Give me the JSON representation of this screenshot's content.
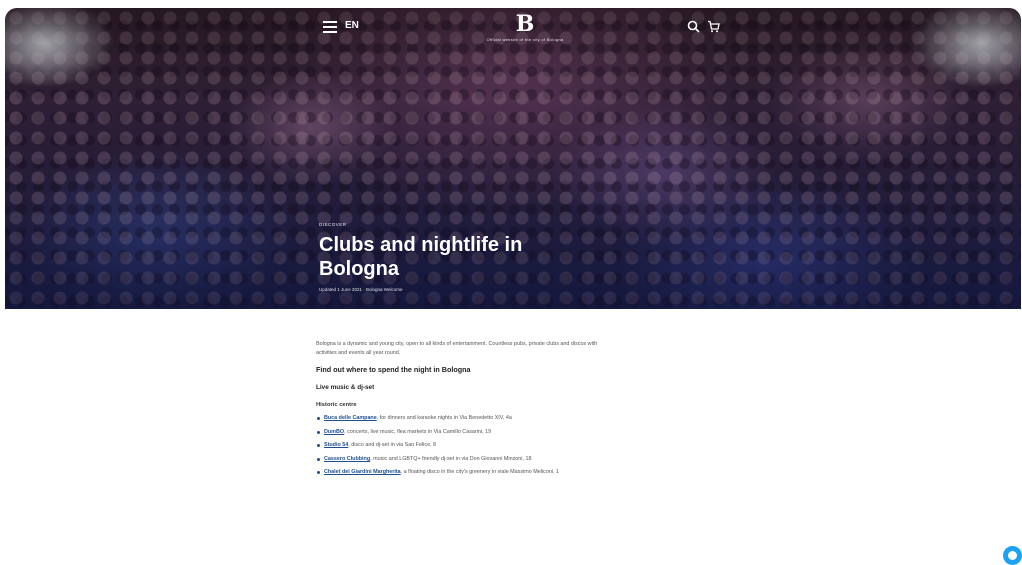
{
  "header": {
    "lang": "EN",
    "logo_mark": "B",
    "logo_sub": "Official website of the city of Bologna"
  },
  "hero": {
    "kicker": "DISCOVER",
    "title": "Clubs and nightlife in Bologna",
    "byline": "Updated 1 June 2021 · Bologna Welcome"
  },
  "article": {
    "intro": "Bologna is a dynamic and young city, open to all kinds of entertainment. Countless pubs, private clubs and discos with activities and events all year round.",
    "heading": "Find out where to spend the night in Bologna",
    "subheading": "Live music & dj-set",
    "section": "Historic centre",
    "venues": [
      {
        "name": "Buca delle Campane",
        "desc": ", for dinners and karaoke nights in Via Benedetto XIV, 4a"
      },
      {
        "name": "DumBO",
        "desc": ", concerts, live music, flea markets in Via Camillo Casarini, 19"
      },
      {
        "name": "Studio 54",
        "desc": ", disco and dj-set in via San Felice, 8"
      },
      {
        "name": "Cassero Clubbing",
        "desc": ", music and LGBTQ+ friendly dj-set in via Don Giovanni Minzoni, 18"
      },
      {
        "name": "Chalet dei Giardini Margherita",
        "desc": ", a floating disco in the city's greenery in viale Massimo Meliconi, 1"
      }
    ]
  },
  "colors": {
    "link": "#1e4f8f",
    "chat": "#1da1f2"
  }
}
